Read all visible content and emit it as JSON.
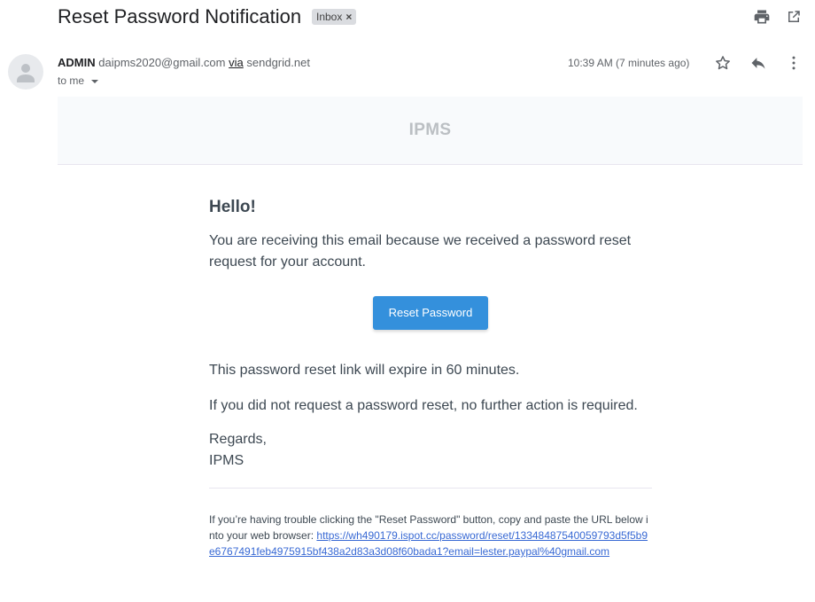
{
  "header": {
    "subject": "Reset Password Notification",
    "label_chip": "Inbox",
    "label_remove": "×"
  },
  "sender": {
    "name": "ADMIN",
    "email": "daipms2020@gmail.com",
    "via_label": "via",
    "via_domain": "sendgrid.net",
    "to_label": "to me",
    "timestamp": "10:39 AM (7 minutes ago)"
  },
  "icons": {
    "print": "printer-icon",
    "new_window": "open-in-new-window-icon",
    "star": "star-icon",
    "reply": "reply-icon",
    "more": "more-vert-icon",
    "avatar": "default-avatar-icon"
  },
  "email": {
    "brand": "IPMS",
    "greeting": "Hello!",
    "intro": "You are receiving this email because we received a password reset request for your account.",
    "button_label": "Reset Password",
    "expire_line": "This password reset link will expire in 60 minutes.",
    "no_action_line": "If you did not request a password reset, no further action is required.",
    "regards": "Regards,",
    "signature": "IPMS",
    "trouble_text": "If you’re having trouble clicking the \"Reset Password\" button, copy and paste the URL below into your web browser:",
    "reset_url": "https://wh490179.ispot.cc/password/reset/13348487540059793d5f5b9e6767491feb4975915bf438a2d83a3d08f60bada1?email=lester.paypal%40gmail.com"
  },
  "colors": {
    "button": "#3490dc",
    "link": "#3869d4",
    "body_text": "#3d4852",
    "band": "#f8fafc"
  }
}
